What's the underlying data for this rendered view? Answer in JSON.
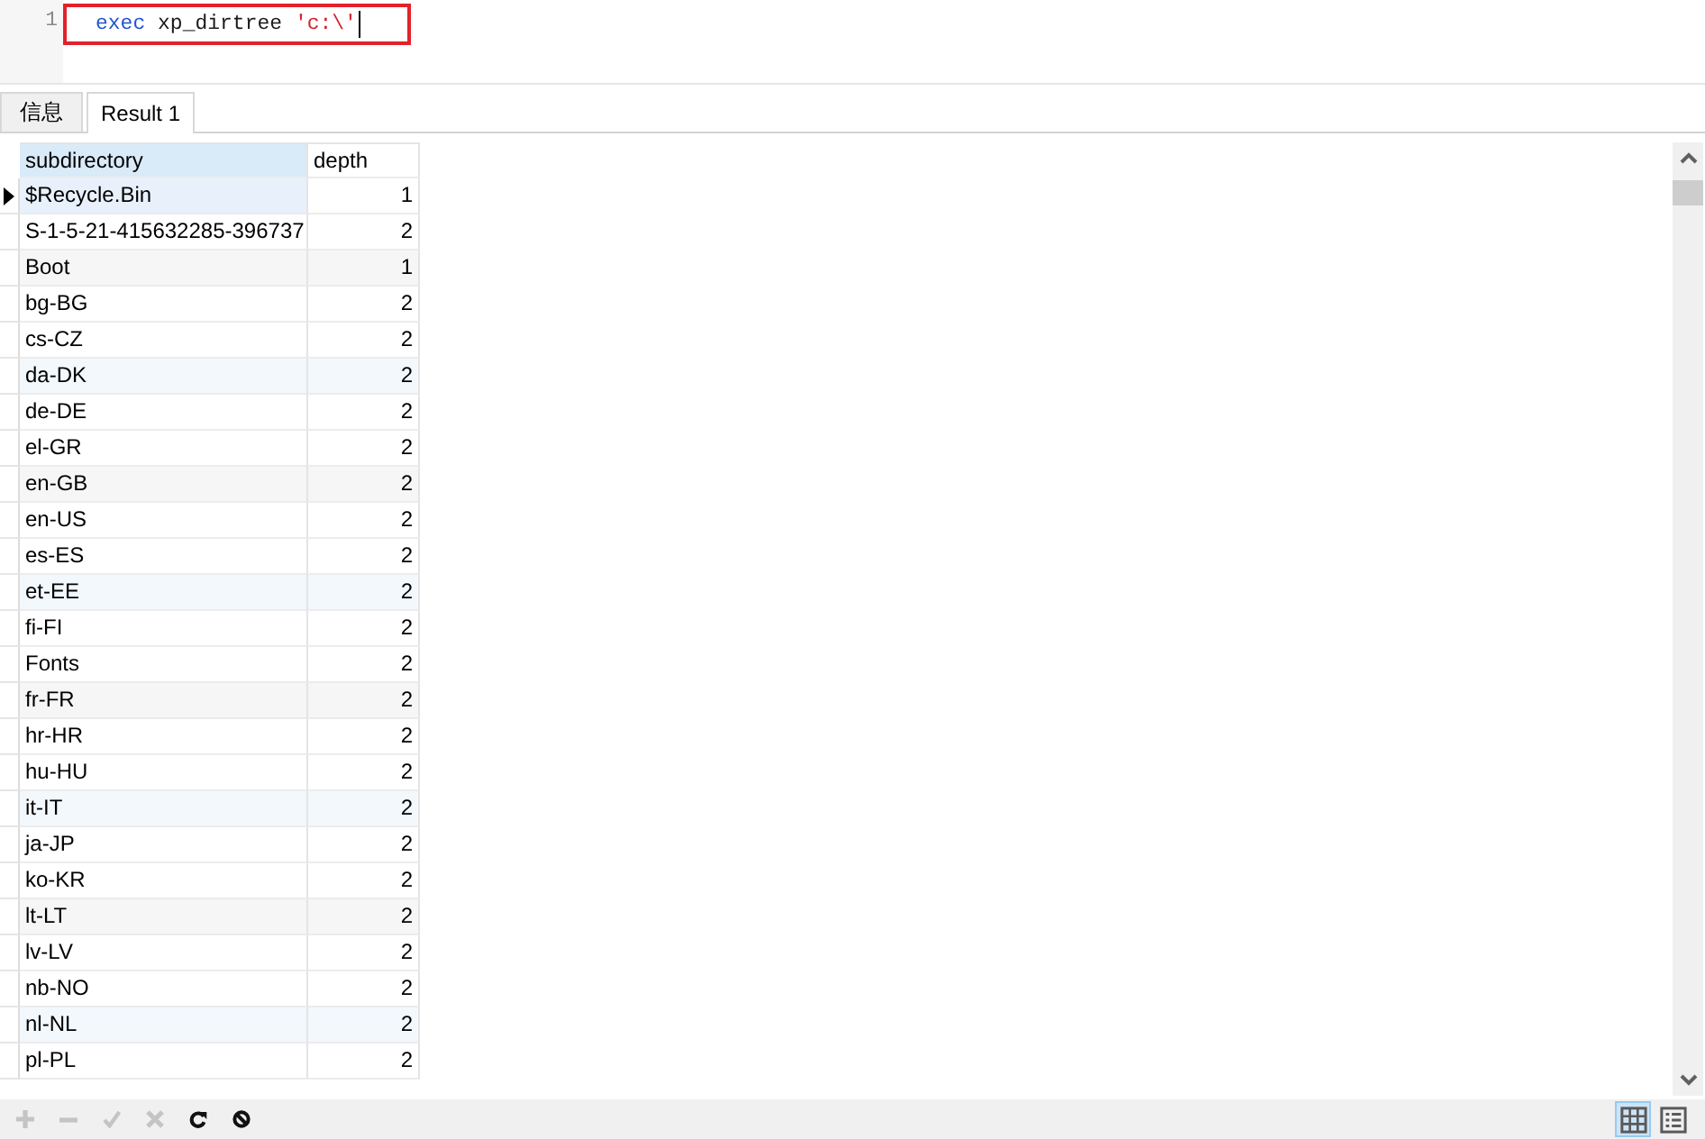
{
  "editor": {
    "lines": [
      {
        "number": "1",
        "boxed": true,
        "cursor": true,
        "tokens": [
          {
            "kind": "keyword",
            "text": "exec"
          },
          {
            "kind": "plain",
            "text": "xp_dirtree"
          },
          {
            "kind": "string",
            "text": "'c:\\'"
          }
        ]
      }
    ]
  },
  "tabs": [
    {
      "label": "信息",
      "selected": false
    },
    {
      "label": "Result 1",
      "selected": true
    }
  ],
  "grid": {
    "columns": [
      {
        "label": "subdirectory",
        "selected": true
      },
      {
        "label": "depth",
        "selected": false
      }
    ],
    "rows": [
      {
        "current": true,
        "cells": [
          "$Recycle.Bin",
          "1"
        ]
      },
      {
        "current": false,
        "cells": [
          "S-1-5-21-415632285-396737",
          "2"
        ]
      },
      {
        "current": false,
        "cells": [
          "Boot",
          "1"
        ]
      },
      {
        "current": false,
        "cells": [
          "bg-BG",
          "2"
        ]
      },
      {
        "current": false,
        "cells": [
          "cs-CZ",
          "2"
        ]
      },
      {
        "current": false,
        "cells": [
          "da-DK",
          "2"
        ]
      },
      {
        "current": false,
        "cells": [
          "de-DE",
          "2"
        ]
      },
      {
        "current": false,
        "cells": [
          "el-GR",
          "2"
        ]
      },
      {
        "current": false,
        "cells": [
          "en-GB",
          "2"
        ]
      },
      {
        "current": false,
        "cells": [
          "en-US",
          "2"
        ]
      },
      {
        "current": false,
        "cells": [
          "es-ES",
          "2"
        ]
      },
      {
        "current": false,
        "cells": [
          "et-EE",
          "2"
        ]
      },
      {
        "current": false,
        "cells": [
          "fi-FI",
          "2"
        ]
      },
      {
        "current": false,
        "cells": [
          "Fonts",
          "2"
        ]
      },
      {
        "current": false,
        "cells": [
          "fr-FR",
          "2"
        ]
      },
      {
        "current": false,
        "cells": [
          "hr-HR",
          "2"
        ]
      },
      {
        "current": false,
        "cells": [
          "hu-HU",
          "2"
        ]
      },
      {
        "current": false,
        "cells": [
          "it-IT",
          "2"
        ]
      },
      {
        "current": false,
        "cells": [
          "ja-JP",
          "2"
        ]
      },
      {
        "current": false,
        "cells": [
          "ko-KR",
          "2"
        ]
      },
      {
        "current": false,
        "cells": [
          "lt-LT",
          "2"
        ]
      },
      {
        "current": false,
        "cells": [
          "lv-LV",
          "2"
        ]
      },
      {
        "current": false,
        "cells": [
          "nb-NO",
          "2"
        ]
      },
      {
        "current": false,
        "cells": [
          "nl-NL",
          "2"
        ]
      },
      {
        "current": false,
        "cells": [
          "pl-PL",
          "2"
        ]
      }
    ]
  },
  "toolbar": {
    "buttons": [
      {
        "kind": "add",
        "disabled": true
      },
      {
        "kind": "delete",
        "disabled": true
      },
      {
        "kind": "apply",
        "disabled": true
      },
      {
        "kind": "discard",
        "disabled": true
      },
      {
        "kind": "refresh",
        "disabled": false
      },
      {
        "kind": "stop",
        "disabled": false
      }
    ],
    "views": [
      {
        "kind": "grid",
        "selected": true
      },
      {
        "kind": "form",
        "selected": false
      }
    ]
  }
}
